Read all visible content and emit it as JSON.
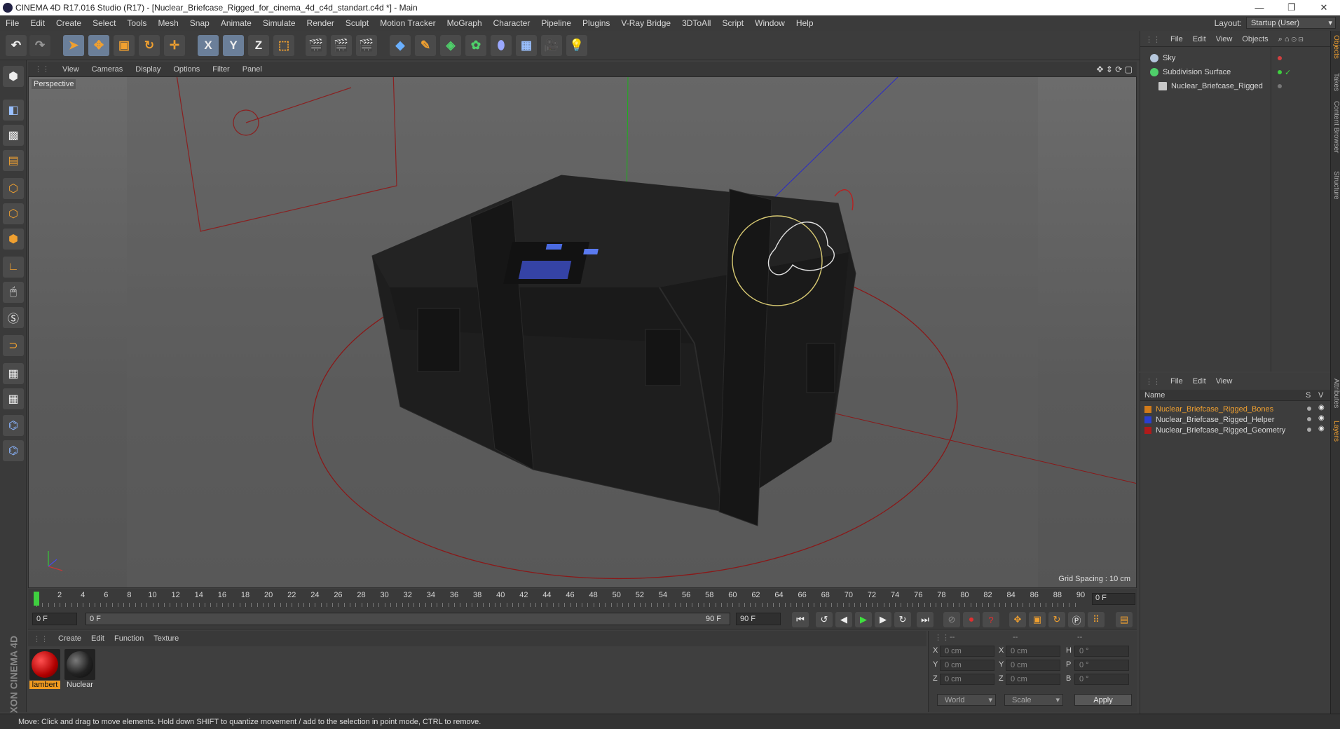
{
  "window": {
    "title": "CINEMA 4D R17.016 Studio (R17) - [Nuclear_Briefcase_Rigged_for_cinema_4d_c4d_standart.c4d *] - Main",
    "minimize": "—",
    "restore": "❐",
    "close": "✕"
  },
  "menu": [
    "File",
    "Edit",
    "Create",
    "Select",
    "Tools",
    "Mesh",
    "Snap",
    "Animate",
    "Simulate",
    "Render",
    "Sculpt",
    "Motion Tracker",
    "MoGraph",
    "Character",
    "Pipeline",
    "Plugins",
    "V-Ray Bridge",
    "3DToAll",
    "Script",
    "Window",
    "Help"
  ],
  "layout": {
    "label": "Layout:",
    "value": "Startup (User)"
  },
  "toolbar": {
    "x_axis": "X",
    "y_axis": "Y",
    "z_axis": "Z"
  },
  "viewport": {
    "menu": [
      "View",
      "Cameras",
      "Display",
      "Options",
      "Filter",
      "Panel"
    ],
    "label": "Perspective",
    "grid_spacing": "Grid Spacing : 10 cm"
  },
  "timeline": {
    "ticks": [
      "0",
      "2",
      "4",
      "6",
      "8",
      "10",
      "12",
      "14",
      "16",
      "18",
      "20",
      "22",
      "24",
      "26",
      "28",
      "30",
      "32",
      "34",
      "36",
      "38",
      "40",
      "42",
      "44",
      "46",
      "48",
      "50",
      "52",
      "54",
      "56",
      "58",
      "60",
      "62",
      "64",
      "66",
      "68",
      "70",
      "72",
      "74",
      "76",
      "78",
      "80",
      "82",
      "84",
      "86",
      "88",
      "90"
    ],
    "current_frame": "0 F"
  },
  "transport": {
    "start": "0 F",
    "range_start": "0 F",
    "range_end": "90 F",
    "end": "90 F"
  },
  "materials": {
    "menu": [
      "Create",
      "Edit",
      "Function",
      "Texture"
    ],
    "items": [
      {
        "label": "lambert",
        "color": "#c00000"
      },
      {
        "label": "Nuclear",
        "color": "#1a1a1a"
      }
    ]
  },
  "coords": {
    "headers": [
      "--",
      "--",
      "--"
    ],
    "rows": [
      {
        "a": "X",
        "av": "0 cm",
        "b": "X",
        "bv": "0 cm",
        "c": "H",
        "cv": "0 °"
      },
      {
        "a": "Y",
        "av": "0 cm",
        "b": "Y",
        "bv": "0 cm",
        "c": "P",
        "cv": "0 °"
      },
      {
        "a": "Z",
        "av": "0 cm",
        "b": "Z",
        "bv": "0 cm",
        "c": "B",
        "cv": "0 °"
      }
    ],
    "world": "World",
    "scale": "Scale",
    "apply": "Apply"
  },
  "status": "Move: Click and drag to move elements. Hold down SHIFT to quantize movement / add to the selection in point mode, CTRL to remove.",
  "maxon": "MAXON CINEMA 4D",
  "object_manager": {
    "menu": [
      "File",
      "Edit",
      "View",
      "Objects"
    ],
    "objects": [
      {
        "name": "Sky",
        "indent": 0
      },
      {
        "name": "Subdivision Surface",
        "indent": 0
      },
      {
        "name": "Nuclear_Briefcase_Rigged",
        "indent": 1
      }
    ]
  },
  "layer_manager": {
    "menu": [
      "File",
      "Edit",
      "View"
    ],
    "col_name": "Name",
    "col_s": "S",
    "col_v": "V",
    "layers": [
      {
        "name": "Nuclear_Briefcase_Rigged_Bones",
        "color": "#d07a1a",
        "text_color": "#f0a030"
      },
      {
        "name": "Nuclear_Briefcase_Rigged_Helper",
        "color": "#2a3fd0",
        "text_color": "#d8d8d8"
      },
      {
        "name": "Nuclear_Briefcase_Rigged_Geometry",
        "color": "#b01a1a",
        "text_color": "#d8d8d8"
      }
    ]
  },
  "right_tabs": [
    "Objects",
    "Takes",
    "Content Browser",
    "Structure",
    "Attributes",
    "Layers"
  ]
}
